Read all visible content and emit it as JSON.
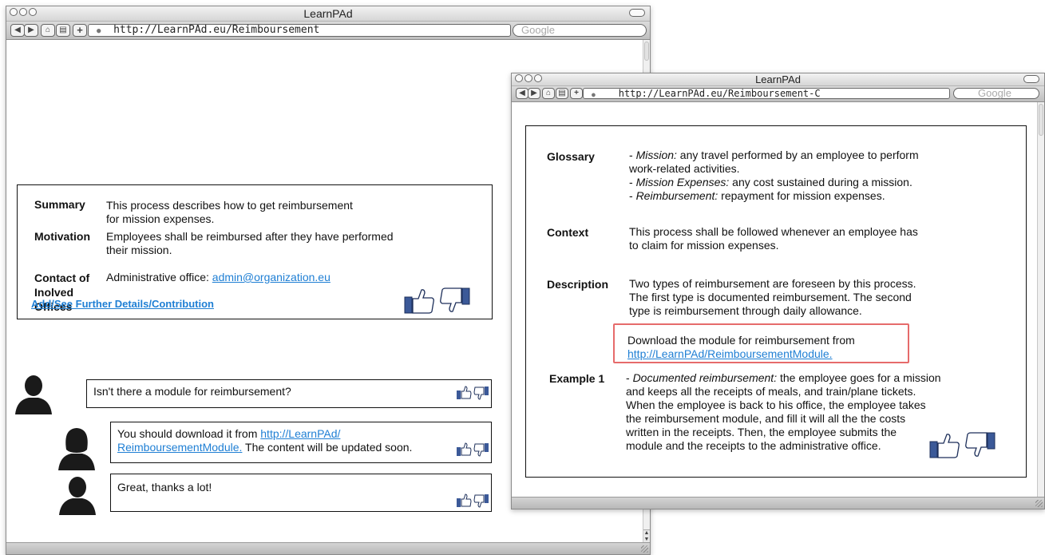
{
  "main_window": {
    "title": "LearnPAd",
    "url": "http://LearnPAd.eu/Reimboursement",
    "search_placeholder": "Google",
    "summary": {
      "summary_label": "Summary",
      "summary_text_line1": "This process describes how to get reimbursement",
      "summary_text_line2": "for mission expenses.",
      "motivation_label": "Motivation",
      "motivation_text_line1": "Employees shall be reimbursed after they have performed",
      "motivation_text_line2": "their mission.",
      "contact_label_line1": "Contact of",
      "contact_label_line2": "Inolved",
      "contact_label_line3": "Offices",
      "contact_text": "Administrative office: ",
      "contact_email": "admin@organization.eu",
      "further_link": "Add/See Further Details/Contribution"
    },
    "comments": [
      {
        "text": "Isn't there a module for reimbursement?"
      },
      {
        "text_before": "You should download it from ",
        "link_line1": "http://LearnPAd/",
        "link_line2": "ReimboursementModule.",
        "text_after": " The content will be updated soon."
      },
      {
        "text": "Great, thanks a lot!"
      }
    ]
  },
  "detail_window": {
    "title": "LearnPAd",
    "url": "http://LearnPAd.eu/Reimboursement-C",
    "search_placeholder": "Google",
    "glossary_label": "Glossary",
    "glossary_lines": [
      {
        "term": "Mission:",
        "prefix": "- ",
        "def": " any travel performed by an employee to perform"
      },
      {
        "term": "",
        "prefix": "",
        "def": "work-related activities."
      },
      {
        "term": "Mission Expenses:",
        "prefix": "- ",
        "def": " any cost sustained during a mission."
      },
      {
        "term": "Reimbursement:",
        "prefix": "- ",
        "def": " repayment for mission expenses."
      }
    ],
    "context_label": "Context",
    "context_line1": "This process shall be followed whenever an employee has",
    "context_line2": "to claim for mission expenses.",
    "description_label": "Description",
    "description_line1": "Two types of reimbursement are foreseen by this process.",
    "description_line2": "The first type is documented reimbursement. The second",
    "description_line3": "type is reimbursement through daily allowance.",
    "download_text": "Download the module for reimbursement from",
    "download_link": "http://LearnPAd/ReimboursementModule.",
    "example_label": "Example 1",
    "example_prefix": "- ",
    "example_term": "Documented reimbursement:",
    "example_line1_rest": " the employee goes for a mission",
    "example_line2": "and keeps all the receipts of meals, and train/plane tickets.",
    "example_line3": "When the employee is back to his office, the employee takes",
    "example_line4": "the reimbursement module, and fill it will all the the costs",
    "example_line5": "written in the receipts. Then, the employee submits the",
    "example_line6": "module and the receipts to the administrative office."
  }
}
